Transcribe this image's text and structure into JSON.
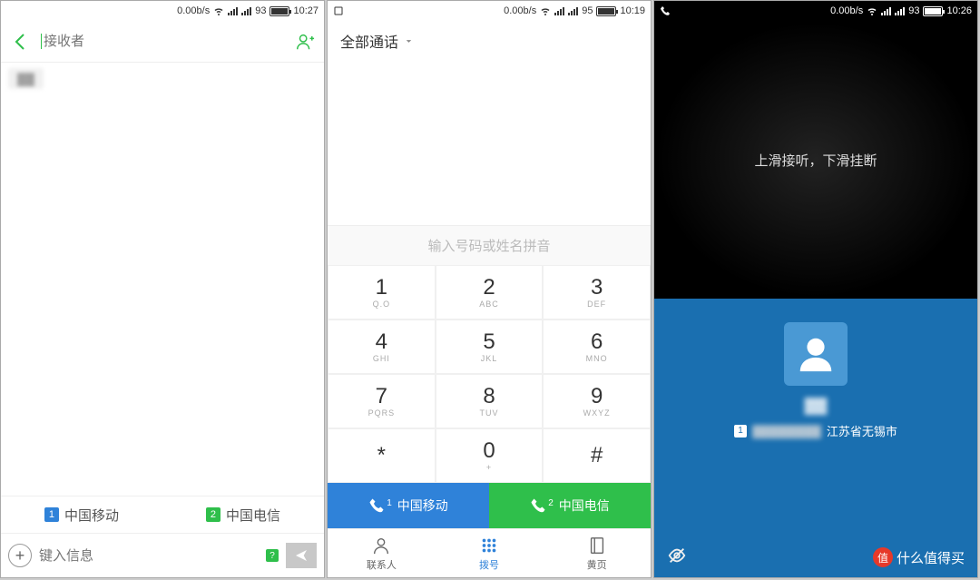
{
  "status": {
    "net_speed": "0.00b/s",
    "battery1": "93",
    "time1": "10:27",
    "battery2": "95",
    "time2": "10:19",
    "battery3": "93",
    "time3": "10:26"
  },
  "s1": {
    "recipient_placeholder": "接收者",
    "chip_text": "▓▓",
    "carrier1": "中国移动",
    "carrier2": "中国电信",
    "msg_placeholder": "键入信息",
    "sim_label1": "1",
    "sim_label2": "2",
    "sim_q": "?"
  },
  "s2": {
    "filter": "全部通话",
    "hint": "输入号码或姓名拼音",
    "keys": [
      {
        "d": "1",
        "s": "Q.O"
      },
      {
        "d": "2",
        "s": "ABC"
      },
      {
        "d": "3",
        "s": "DEF"
      },
      {
        "d": "4",
        "s": "GHI"
      },
      {
        "d": "5",
        "s": "JKL"
      },
      {
        "d": "6",
        "s": "MNO"
      },
      {
        "d": "7",
        "s": "PQRS"
      },
      {
        "d": "8",
        "s": "TUV"
      },
      {
        "d": "9",
        "s": "WXYZ"
      },
      {
        "d": "*",
        "s": ""
      },
      {
        "d": "0",
        "s": "+"
      },
      {
        "d": "#",
        "s": ""
      }
    ],
    "call1_label": "中国移动",
    "call1_num": "1",
    "call2_label": "中国电信",
    "call2_num": "2",
    "nav": {
      "contacts": "联系人",
      "dial": "拨号",
      "pages": "黄页"
    }
  },
  "s3": {
    "hint": "上滑接听，下滑挂断",
    "name": "▓▓",
    "sim": "1",
    "number_blur": "▓▓▓▓▓▓▓▓",
    "location": "江苏省无锡市",
    "watermark": "什么值得买",
    "watermark_badge": "值"
  }
}
